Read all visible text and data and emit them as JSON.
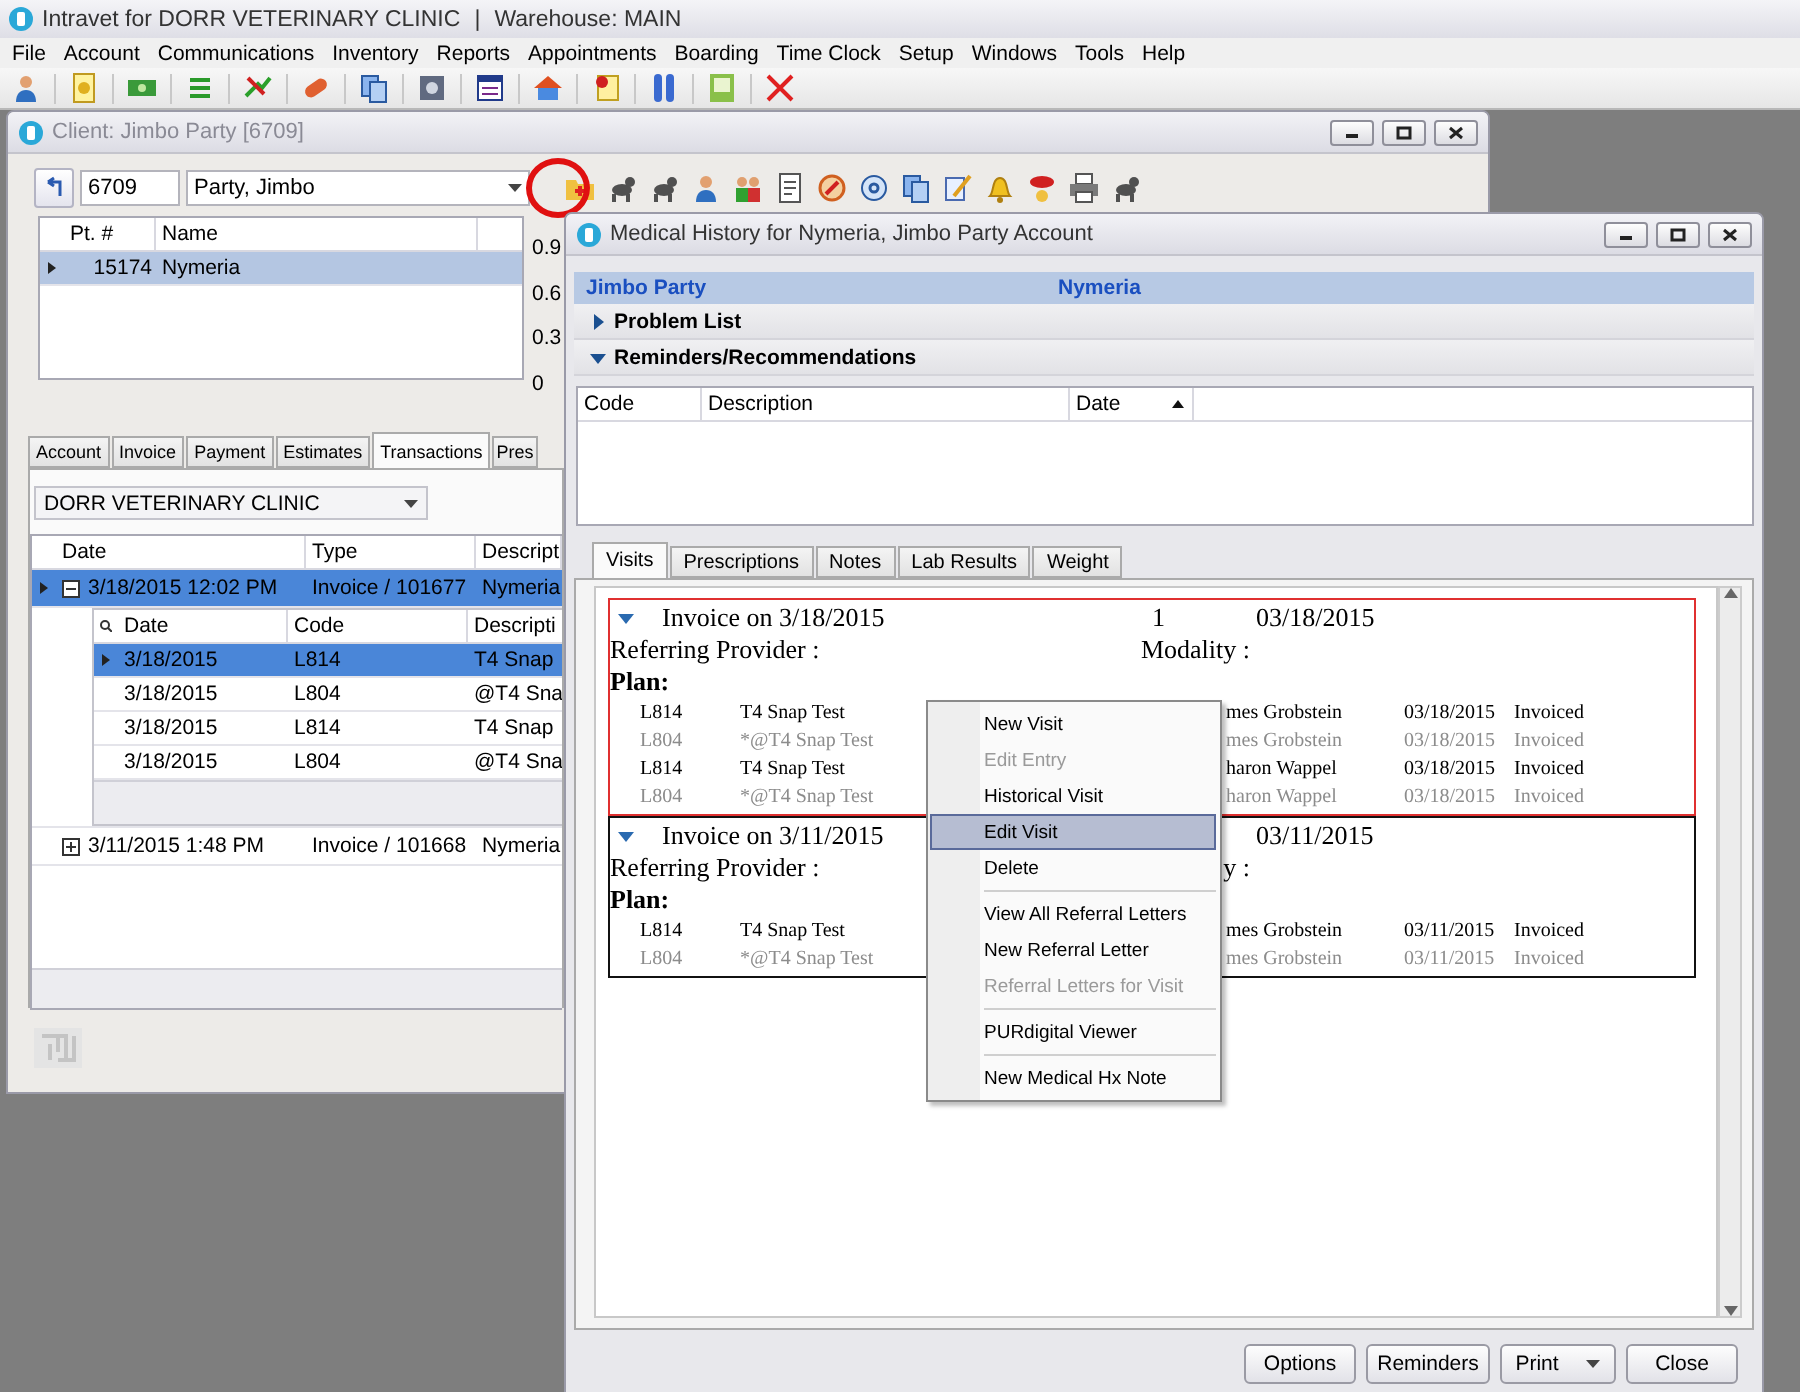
{
  "app": {
    "title": "Intravet for DORR VETERINARY CLINIC",
    "separator": "|",
    "warehouse": "Warehouse: MAIN"
  },
  "menu": [
    "File",
    "Account",
    "Communications",
    "Inventory",
    "Reports",
    "Appointments",
    "Boarding",
    "Time Clock",
    "Setup",
    "Windows",
    "Tools",
    "Help"
  ],
  "client_window": {
    "title": "Client: Jimbo Party [6709]",
    "client_number": "6709",
    "client_name": "Party, Jimbo",
    "patients": {
      "columns": [
        "Pt. #",
        "Name"
      ],
      "rows": [
        {
          "number": "15174",
          "name": "Nymeria",
          "selected": true
        }
      ]
    },
    "axis": [
      "0.9",
      "0.6",
      "0.3",
      "0"
    ],
    "tabs": [
      {
        "label": "Account",
        "selected": false
      },
      {
        "label": "Invoice",
        "selected": false
      },
      {
        "label": "Payment",
        "selected": false
      },
      {
        "label": "Estimates",
        "selected": false
      },
      {
        "label": "Transactions",
        "selected": true
      },
      {
        "label": "Pres",
        "selected": false
      }
    ],
    "clinic": "DORR VETERINARY CLINIC",
    "transactions": {
      "columns": [
        "Date",
        "Type",
        "Descript"
      ],
      "rows": [
        {
          "date": "3/18/2015 12:02 PM",
          "type": "Invoice / 101677",
          "description": "Nymeria",
          "selected": true,
          "expanded": true,
          "detail": {
            "columns": [
              "Date",
              "Code",
              "Descripti"
            ],
            "rows": [
              {
                "date": "3/18/2015",
                "code": "L814",
                "description": "T4 Snap",
                "selected": true
              },
              {
                "date": "3/18/2015",
                "code": "L804",
                "description": "@T4 Sna",
                "selected": false
              },
              {
                "date": "3/18/2015",
                "code": "L814",
                "description": "T4 Snap",
                "selected": false
              },
              {
                "date": "3/18/2015",
                "code": "L804",
                "description": "@T4 Sna",
                "selected": false
              }
            ]
          }
        },
        {
          "date": "3/11/2015 1:48 PM",
          "type": "Invoice / 101668",
          "description": "Nymeria",
          "selected": false,
          "expanded": false
        }
      ]
    }
  },
  "medical_window": {
    "title": "Medical History for Nymeria, Jimbo Party Account",
    "owner": "Jimbo Party",
    "patient": "Nymeria",
    "sections": [
      {
        "label": "Problem List",
        "expanded": false
      },
      {
        "label": "Reminders/Recommendations",
        "expanded": true
      }
    ],
    "reminder_columns": [
      "Code",
      "Description",
      "Date"
    ],
    "tabs": [
      {
        "label": "Visits",
        "selected": true
      },
      {
        "label": "Prescriptions",
        "selected": false
      },
      {
        "label": "Notes",
        "selected": false
      },
      {
        "label": "Lab Results",
        "selected": false
      },
      {
        "label": "Weight",
        "selected": false
      }
    ],
    "visits": [
      {
        "title": "Invoice on 3/18/2015",
        "number": "1",
        "date": "03/18/2015",
        "referring": "Referring Provider :",
        "modality": "Modality :",
        "plan": "Plan:",
        "highlighted": true,
        "lines": [
          {
            "code": "L814",
            "description": "T4 Snap Test",
            "provider": "mes Grobstein",
            "date": "03/18/2015",
            "status": "Invoiced",
            "disabled": false
          },
          {
            "code": "L804",
            "description": "*@T4 Snap Test",
            "provider": "mes Grobstein",
            "date": "03/18/2015",
            "status": "Invoiced",
            "disabled": true
          },
          {
            "code": "L814",
            "description": "T4 Snap Test",
            "provider": "haron Wappel",
            "date": "03/18/2015",
            "status": "Invoiced",
            "disabled": false
          },
          {
            "code": "L804",
            "description": "*@T4 Snap Test",
            "provider": "haron Wappel",
            "date": "03/18/2015",
            "status": "Invoiced",
            "disabled": true
          }
        ]
      },
      {
        "title": "Invoice on 3/11/2015",
        "date": "03/11/2015",
        "referring": "Referring Provider :",
        "modality": "y :",
        "plan": "Plan:",
        "highlighted": false,
        "lines": [
          {
            "code": "L814",
            "description": "T4 Snap Test",
            "provider": "mes Grobstein",
            "date": "03/11/2015",
            "status": "Invoiced",
            "disabled": false
          },
          {
            "code": "L804",
            "description": "*@T4 Snap Test",
            "provider": "mes Grobstein",
            "date": "03/11/2015",
            "status": "Invoiced",
            "disabled": true
          }
        ]
      }
    ],
    "buttons": [
      {
        "label": "Options",
        "kind": "button"
      },
      {
        "label": "Reminders",
        "kind": "button"
      },
      {
        "label": "Print",
        "kind": "dropdown"
      },
      {
        "label": "Close",
        "kind": "button"
      }
    ]
  },
  "context_menu": {
    "groups": [
      [
        {
          "label": "New Visit",
          "disabled": false,
          "selected": false
        },
        {
          "label": "Edit Entry",
          "disabled": true,
          "selected": false
        },
        {
          "label": "Historical Visit",
          "disabled": false,
          "selected": false
        },
        {
          "label": "Edit Visit",
          "disabled": false,
          "selected": true
        },
        {
          "label": "Delete",
          "disabled": false,
          "selected": false
        }
      ],
      [
        {
          "label": "View All Referral Letters",
          "disabled": false,
          "selected": false
        },
        {
          "label": "New Referral Letter",
          "disabled": false,
          "selected": false
        },
        {
          "label": "Referral Letters for Visit",
          "disabled": true,
          "selected": false
        }
      ],
      [
        {
          "label": "PURdigital Viewer",
          "disabled": false,
          "selected": false
        }
      ],
      [
        {
          "label": "New Medical Hx Note",
          "disabled": false,
          "selected": false
        }
      ]
    ]
  }
}
